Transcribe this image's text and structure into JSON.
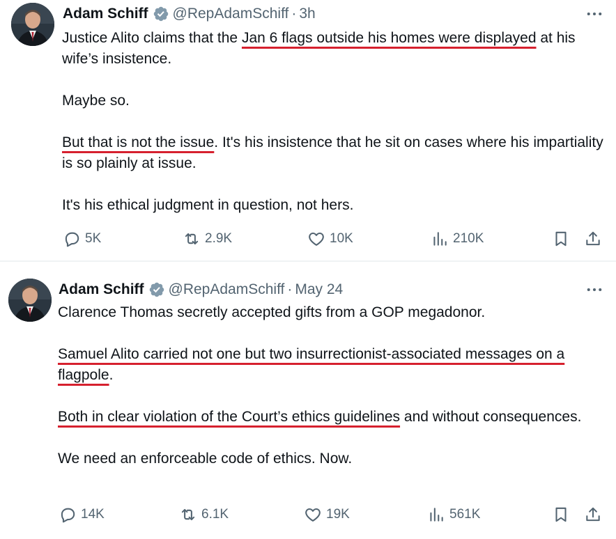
{
  "colors": {
    "text": "#0f1419",
    "secondary": "#536471",
    "verified": "#829aab",
    "underline": "#d6202e",
    "divider": "#eff3f4"
  },
  "tweets": [
    {
      "author": {
        "name": "Adam Schiff",
        "verified_icon": "verified-badge-icon",
        "handle": "@RepAdamSchiff",
        "separator": "·",
        "time": "3h"
      },
      "paragraphs": [
        [
          {
            "text": "Justice Alito claims that the ",
            "underline": false
          },
          {
            "text": "Jan 6 flags outside his homes were displayed",
            "underline": true
          },
          {
            "text": " at his wife’s insistence.",
            "underline": false
          }
        ],
        [
          {
            "text": "Maybe so.",
            "underline": false
          }
        ],
        [
          {
            "text": "But that is not the issue",
            "underline": true
          },
          {
            "text": ". It's his insistence that he sit on cases where his impartiality is so plainly at issue.",
            "underline": false
          }
        ],
        [
          {
            "text": "It's his ethical judgment in question, not hers.",
            "underline": false
          }
        ]
      ],
      "metrics": {
        "replies": "5K",
        "reposts": "2.9K",
        "likes": "10K",
        "views": "210K"
      }
    },
    {
      "author": {
        "name": "Adam Schiff",
        "verified_icon": "verified-badge-icon",
        "handle": "@RepAdamSchiff",
        "separator": "·",
        "time": "May 24"
      },
      "paragraphs": [
        [
          {
            "text": "Clarence Thomas secretly accepted gifts from a GOP megadonor.",
            "underline": false
          }
        ],
        [
          {
            "text": "Samuel Alito carried not one but two insurrectionist-associated messages on a flagpole",
            "underline": true
          },
          {
            "text": ".",
            "underline": false
          }
        ],
        [
          {
            "text": "Both in clear violation of the Court’s ethics guidelines",
            "underline": true
          },
          {
            "text": " and without consequences.",
            "underline": false
          }
        ],
        [
          {
            "text": "We need an enforceable code of ethics. Now.",
            "underline": false
          }
        ]
      ],
      "metrics": {
        "replies": "14K",
        "reposts": "6.1K",
        "likes": "19K",
        "views": "561K"
      }
    }
  ]
}
